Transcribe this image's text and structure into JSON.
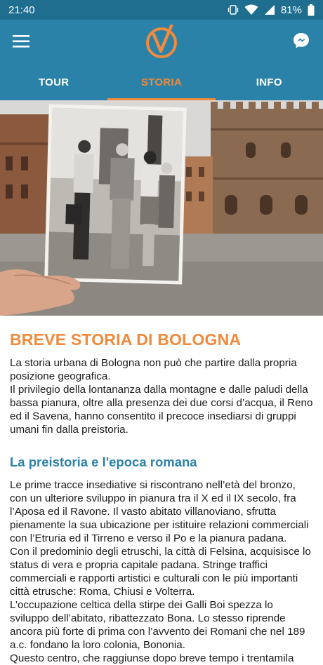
{
  "status_bar": {
    "time": "21:40",
    "battery": "81%",
    "icons": [
      "vibrate-icon",
      "wifi-icon",
      "signal-icon",
      "battery-icon"
    ]
  },
  "app_bar": {
    "menu_icon": "menu-icon",
    "logo": "v-logo",
    "messenger_icon": "messenger-icon"
  },
  "tabs": [
    {
      "label": "TOUR",
      "active": false
    },
    {
      "label": "STORIA",
      "active": true
    },
    {
      "label": "INFO",
      "active": false
    }
  ],
  "article": {
    "title": "BREVE STORIA DI BOLOGNA",
    "intro": "La storia urbana di Bologna non può che partire dalla propria posizione geografica.\nIl privilegio della lontananza dalla montagne e dalle paludi della bassa pianura, oltre alla presenza dei due corsi d’acqua, il Reno ed il Savena, hanno consentito il precoce insediarsi di gruppi umani fin dalla preistoria.",
    "section_title": "La preistoria e l'epoca romana",
    "section_text": "Le prime tracce insediative si riscontrano nell’età del bronzo, con un ulteriore sviluppo in pianura tra il X ed il IX secolo, fra l’Aposa ed il Ravone. Il vasto abitato villanoviano, sfrutta pienamente la sua ubicazione per istituire relazioni commerciali con l’Etruria ed il Tirreno e verso il Po e la pianura padana.\nCon il predominio degli etruschi, la città di Felsina, acquisisce lo status di vera e propria capitale padana. Stringe traffici commerciali e rapporti artistici e culturali con le più importanti città etrusche: Roma, Chiusi e Volterra.\nL’occupazione celtica della stirpe dei Galli Boi spezza lo sviluppo dell’abitato, ribattezzato Bona. Lo stesso riprende ancora più forte di prima con l’avvento dei Romani che nel 189 a.c. fondano la loro colonia, Bononia.\nQuesto centro, che raggiunse dopo breve tempo i trentamila"
  },
  "colors": {
    "status_bar": "#1f6e8f",
    "app_bar": "#2b82a8",
    "accent": "#f08a3c",
    "heading_blue": "#2b82a8"
  }
}
